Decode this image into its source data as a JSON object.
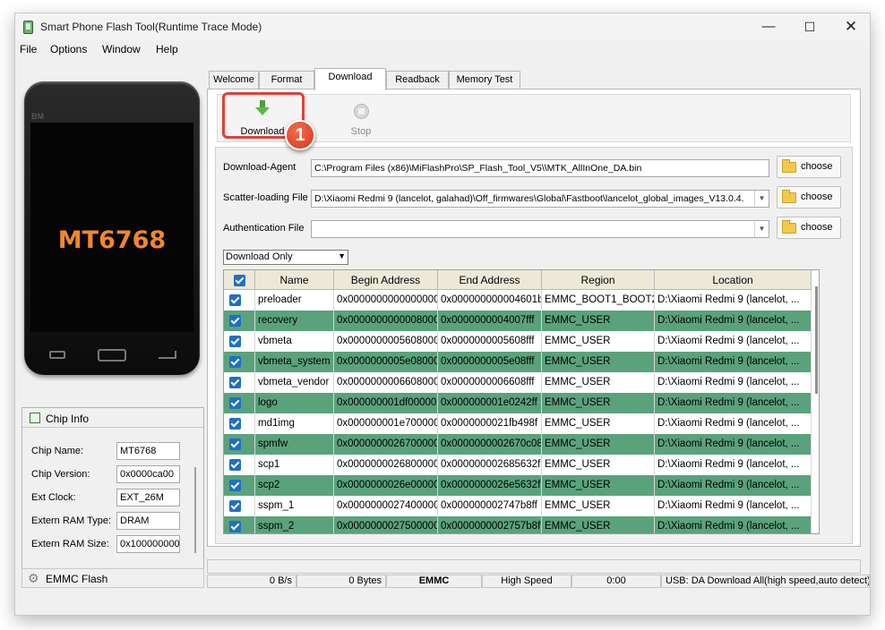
{
  "window": {
    "title": "Smart Phone Flash Tool(Runtime Trace Mode)"
  },
  "menu": [
    "File",
    "Options",
    "Window",
    "Help"
  ],
  "phone": {
    "brand": "BM",
    "chip": "MT6768"
  },
  "chip_info": {
    "title": "Chip Info",
    "rows": [
      {
        "label": "Chip Name:",
        "value": "MT6768"
      },
      {
        "label": "Chip Version:",
        "value": "0x0000ca00"
      },
      {
        "label": "Ext Clock:",
        "value": "EXT_26M"
      },
      {
        "label": "Extern RAM Type:",
        "value": "DRAM"
      },
      {
        "label": "Extern RAM Size:",
        "value": "0x100000000"
      }
    ]
  },
  "emmc_flash": "EMMC Flash",
  "tabs": [
    "Welcome",
    "Format",
    "Download",
    "Readback",
    "Memory Test"
  ],
  "toolbar": {
    "download": "Download",
    "stop": "Stop",
    "step_badge": "1"
  },
  "form": {
    "download_agent_label": "Download-Agent",
    "download_agent_value": "C:\\Program Files (x86)\\MiFlashPro\\SP_Flash_Tool_V5\\\\MTK_AllInOne_DA.bin",
    "scatter_label": "Scatter-loading File",
    "scatter_value": "D:\\Xiaomi Redmi 9 (lancelot, galahad)\\Off_firmwares\\Global\\Fastboot\\lancelot_global_images_V13.0.4.",
    "auth_label": "Authentication File",
    "auth_value": "",
    "choose": "choose",
    "mode": "Download Only"
  },
  "table": {
    "headers": [
      "Name",
      "Begin Address",
      "End Address",
      "Region",
      "Location"
    ],
    "rows": [
      {
        "name": "preloader",
        "begin": "0x0000000000000000",
        "end": "0x000000000004601b",
        "region": "EMMC_BOOT1_BOOT2",
        "location": "D:\\Xiaomi Redmi 9 (lancelot, ..."
      },
      {
        "name": "recovery",
        "begin": "0x0000000000008000",
        "end": "0x0000000004007fff",
        "region": "EMMC_USER",
        "location": "D:\\Xiaomi Redmi 9 (lancelot, ..."
      },
      {
        "name": "vbmeta",
        "begin": "0x0000000005608000",
        "end": "0x0000000005608fff",
        "region": "EMMC_USER",
        "location": "D:\\Xiaomi Redmi 9 (lancelot, ..."
      },
      {
        "name": "vbmeta_system",
        "begin": "0x0000000005e08000",
        "end": "0x0000000005e08fff",
        "region": "EMMC_USER",
        "location": "D:\\Xiaomi Redmi 9 (lancelot, ..."
      },
      {
        "name": "vbmeta_vendor",
        "begin": "0x0000000006608000",
        "end": "0x0000000006608fff",
        "region": "EMMC_USER",
        "location": "D:\\Xiaomi Redmi 9 (lancelot, ..."
      },
      {
        "name": "logo",
        "begin": "0x000000001df00000",
        "end": "0x000000001e0242ff",
        "region": "EMMC_USER",
        "location": "D:\\Xiaomi Redmi 9 (lancelot, ..."
      },
      {
        "name": "md1img",
        "begin": "0x000000001e700000",
        "end": "0x0000000021fb498f",
        "region": "EMMC_USER",
        "location": "D:\\Xiaomi Redmi 9 (lancelot, ..."
      },
      {
        "name": "spmfw",
        "begin": "0x0000000026700000",
        "end": "0x0000000002670c08f",
        "region": "EMMC_USER",
        "location": "D:\\Xiaomi Redmi 9 (lancelot, ..."
      },
      {
        "name": "scp1",
        "begin": "0x0000000026800000",
        "end": "0x000000002685632f",
        "region": "EMMC_USER",
        "location": "D:\\Xiaomi Redmi 9 (lancelot, ..."
      },
      {
        "name": "scp2",
        "begin": "0x0000000026e00000",
        "end": "0x0000000026e5632f",
        "region": "EMMC_USER",
        "location": "D:\\Xiaomi Redmi 9 (lancelot, ..."
      },
      {
        "name": "sspm_1",
        "begin": "0x0000000027400000",
        "end": "0x000000002747b8ff",
        "region": "EMMC_USER",
        "location": "D:\\Xiaomi Redmi 9 (lancelot, ..."
      },
      {
        "name": "sspm_2",
        "begin": "0x0000000027500000",
        "end": "0x0000000002757b8ff",
        "region": "EMMC_USER",
        "location": "D:\\Xiaomi Redmi 9 (lancelot, ..."
      }
    ]
  },
  "status": {
    "speed": "0 B/s",
    "bytes": "0 Bytes",
    "storage": "EMMC",
    "mode": "High Speed",
    "time": "0:00",
    "usb": "USB: DA Download All(high speed,auto detect)"
  },
  "colors": {
    "accent_green_row": "#5aa27c",
    "highlight": "#e0403a",
    "chip_text": "#f0882a"
  }
}
